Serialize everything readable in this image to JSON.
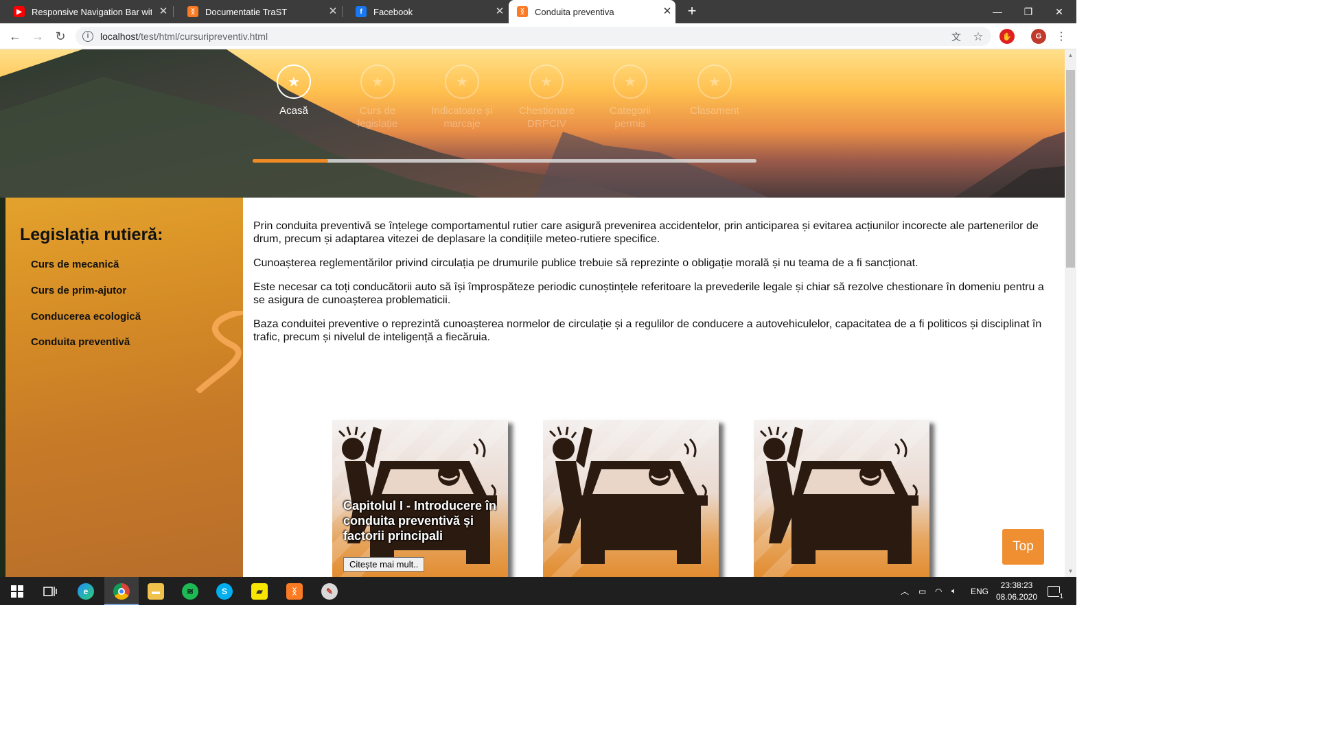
{
  "browser": {
    "tabs": [
      {
        "title": "Responsive Navigation Bar with I",
        "icon": "youtube-icon",
        "color": "#ff0000"
      },
      {
        "title": "Documentatie TraST",
        "icon": "xampp-icon",
        "color": "#fb7a24"
      },
      {
        "title": "Facebook",
        "icon": "facebook-icon",
        "color": "#1877f2"
      },
      {
        "title": "Conduita preventiva",
        "icon": "xampp-icon",
        "color": "#fb7a24"
      }
    ],
    "url_host": "localhost",
    "url_path": "/test/html/cursuripreventiv.html",
    "profile_initial": "G"
  },
  "nav": {
    "items": [
      {
        "label": "Acasă",
        "active": true
      },
      {
        "label": "Curs de legislație",
        "active": false
      },
      {
        "label": "Indicatoare și marcaje",
        "active": false
      },
      {
        "label": "Chestionare DRPCIV",
        "active": false
      },
      {
        "label": "Categorii permis",
        "active": false
      },
      {
        "label": "Clasament",
        "active": false
      }
    ],
    "progress": 0.15
  },
  "sidebar": {
    "title": "Legislația rutieră:",
    "links": [
      "Curs de mecanică",
      "Curs de prim-ajutor",
      "Conducerea ecologică",
      "Conduita preventivă"
    ]
  },
  "content": {
    "paragraphs": [
      "Prin conduita preventivă se înțelege comportamentul rutier care asigură prevenirea accidentelor, prin anticiparea și evitarea acțiunilor incorecte ale partenerilor de drum, precum și adaptarea vitezei de deplasare la condițiile meteo-rutiere specifice.",
      "Cunoașterea reglementărilor privind circulația pe drumurile publice trebuie să reprezinte o obligație morală și nu teama de a fi sancționat.",
      "Este necesar ca toți conducătorii auto să își împrospăteze periodic cunoștințele referitoare la prevederile legale și chiar să rezolve chestionare în domeniu pentru a se asigura de cunoașterea problematicii.",
      "Baza conduitei preventive o reprezintă cunoașterea normelor de circulație și a regulilor de conducere a autovehiculelor, capacitatea de a fi politicos și disciplinat în trafic, precum și nivelul de inteligență a fiecăruia."
    ],
    "cards": [
      {
        "title": "Capitolul I - Introducere în conduita preventivă și factorii principali",
        "button": "Citește mai mult.."
      },
      {
        "title": "",
        "button": ""
      },
      {
        "title": "",
        "button": ""
      }
    ],
    "top_button": "Top"
  },
  "taskbar": {
    "language": "ENG",
    "time": "23:38:23",
    "date": "08.06.2020",
    "notifications": "1"
  }
}
